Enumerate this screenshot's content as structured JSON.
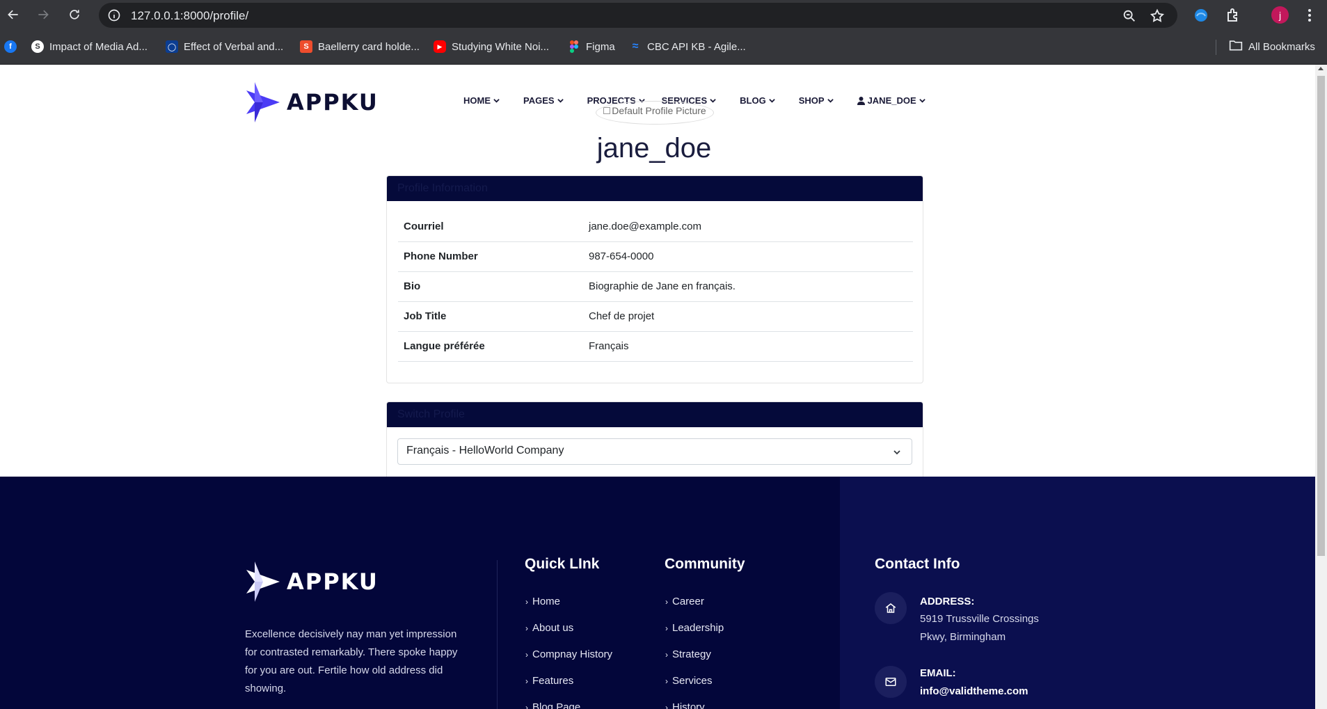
{
  "browser": {
    "url": "127.0.0.1:8000/profile/",
    "profile_initial": "j",
    "bookmarks": [
      {
        "label": "Impact of Media Ad...",
        "icon": "s-icon",
        "color": "#ffffff"
      },
      {
        "label": "Effect of Verbal and...",
        "icon": "c-icon",
        "color": "#0b3d91"
      },
      {
        "label": "Baellerry card holde...",
        "icon": "shopping-bag-icon",
        "color": "#ee4d2d"
      },
      {
        "label": "Studying White Noi...",
        "icon": "youtube-icon",
        "color": "#ff0000"
      },
      {
        "label": "Figma",
        "icon": "figma-icon",
        "color": "#f24e1e"
      },
      {
        "label": "CBC API KB - Agile...",
        "icon": "confluence-icon",
        "color": "#2684ff"
      }
    ],
    "all_bookmarks_label": "All Bookmarks"
  },
  "header": {
    "logo_text": "APPKU",
    "nav": [
      {
        "label": "HOME"
      },
      {
        "label": "PAGES"
      },
      {
        "label": "PROJECTS"
      },
      {
        "label": "SERVICES"
      },
      {
        "label": "BLOG"
      },
      {
        "label": "SHOP"
      },
      {
        "label": "JANE_DOE"
      }
    ],
    "profile_picture_alt": "Default Profile Picture"
  },
  "profile": {
    "username": "jane_doe",
    "info_title": "Profile Information",
    "rows": [
      {
        "label": "Courriel",
        "value": "jane.doe@example.com"
      },
      {
        "label": "Phone Number",
        "value": "987-654-0000"
      },
      {
        "label": "Bio",
        "value": "Biographie de Jane en français."
      },
      {
        "label": "Job Title",
        "value": "Chef de projet"
      },
      {
        "label": "Langue préférée",
        "value": "Français"
      }
    ],
    "switch_title": "Switch Profile",
    "switch_selected": "Français - HelloWorld Company"
  },
  "footer": {
    "logo_text": "APPKU",
    "about": "Excellence decisively nay man yet impression for contrasted remarkably. There spoke happy for you are out. Fertile how old address did showing.",
    "quick_link": {
      "title": "Quick LInk",
      "items": [
        "Home",
        "About us",
        "Compnay History",
        "Features",
        "Blog Page"
      ]
    },
    "community": {
      "title": "Community",
      "items": [
        "Career",
        "Leadership",
        "Strategy",
        "Services",
        "History"
      ]
    },
    "contact": {
      "title": "Contact Info",
      "address_label": "ADDRESS:",
      "address_line1": "5919 Trussville Crossings",
      "address_line2": "Pkwy, Birmingham",
      "email_label": "EMAIL:",
      "email_value": "info@validtheme.com"
    }
  },
  "colors": {
    "navy": "#03063a",
    "footer_right": "#0b0f4f",
    "accent_purple": "#5b3df5"
  }
}
